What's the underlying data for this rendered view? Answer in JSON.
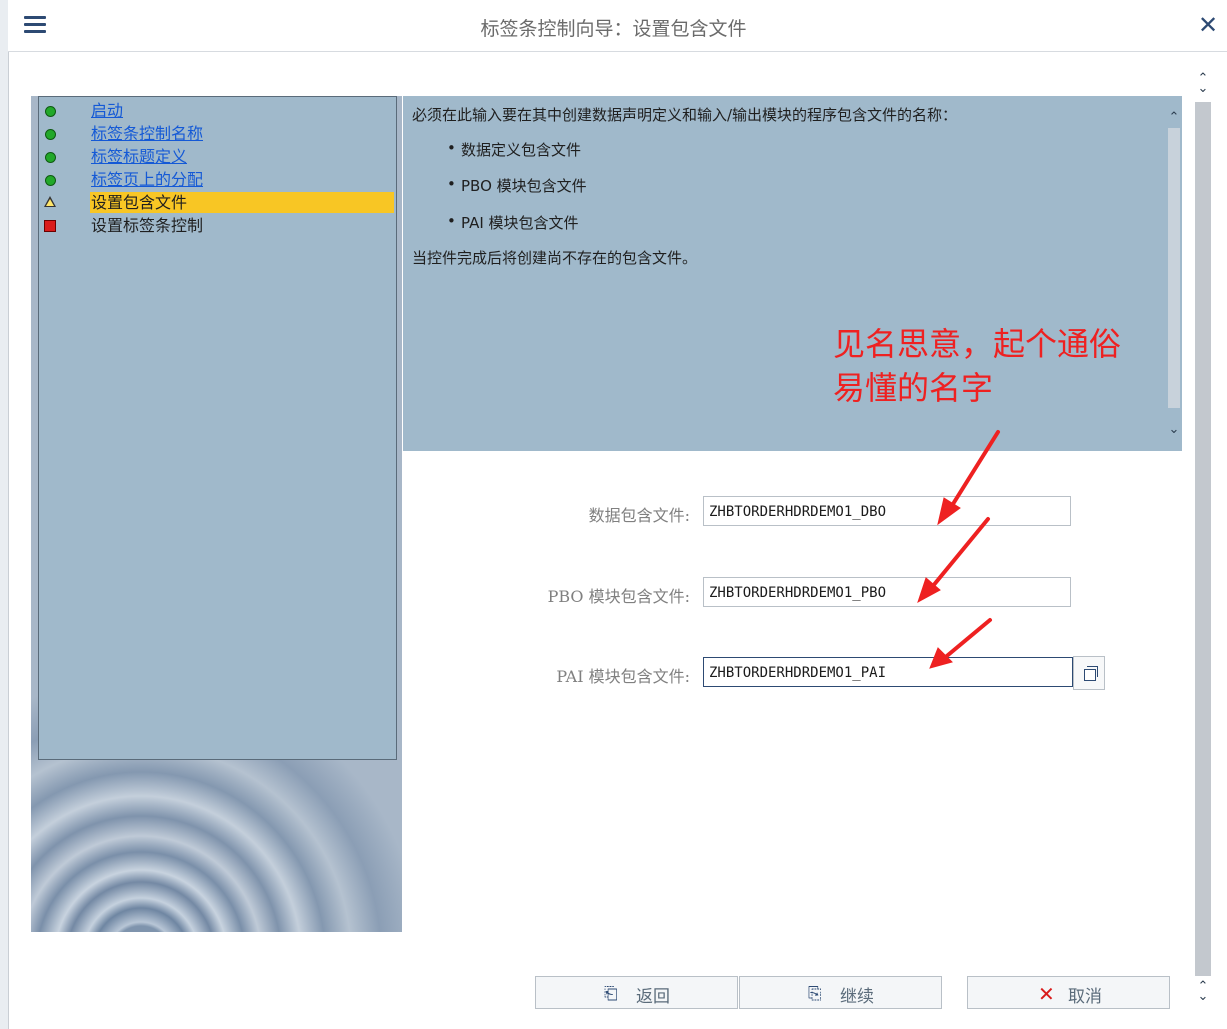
{
  "window": {
    "title": "标签条控制向导：设置包含文件",
    "menu_icon": "hamburger-menu-icon",
    "close_icon": "close-x-icon"
  },
  "steps": [
    {
      "label": "启动",
      "status": "done",
      "link": true
    },
    {
      "label": "标签条控制名称",
      "status": "done",
      "link": true
    },
    {
      "label": "标签标题定义",
      "status": "done",
      "link": true
    },
    {
      "label": "标签页上的分配",
      "status": "done",
      "link": true
    },
    {
      "label": "设置包含文件",
      "status": "current",
      "link": false
    },
    {
      "label": "设置标签条控制",
      "status": "pending",
      "link": false
    }
  ],
  "description": {
    "intro": "必须在此输入要在其中创建数据声明定义和输入/输出模块的程序包含文件的名称：",
    "bullets": [
      "数据定义包含文件",
      "PBO 模块包含文件",
      "PAI 模块包含文件"
    ],
    "note": "当控件完成后将创建尚不存在的包含文件。"
  },
  "annotation": {
    "line1": "见名思意，起个通俗",
    "line2": "易懂的名字",
    "color": "#ee2121"
  },
  "form": {
    "data_label": "数据包含文件:",
    "data_value": "ZHBTORDERHDRDEMO1_DBO",
    "pbo_label": "PBO 模块包含文件:",
    "pbo_value": "ZHBTORDERHDRDEMO1_PBO",
    "pai_label": "PAI 模块包含文件:",
    "pai_value": "ZHBTORDERHDRDEMO1_PAI"
  },
  "buttons": {
    "back": "返回",
    "continue": "继续",
    "cancel": "取消"
  },
  "colors": {
    "accent": "#2d4a73",
    "panel": "#a0b9cb",
    "highlight": "#f8c624",
    "done": "#22a82a",
    "pending": "#d91b1b",
    "link": "#1459d6"
  }
}
